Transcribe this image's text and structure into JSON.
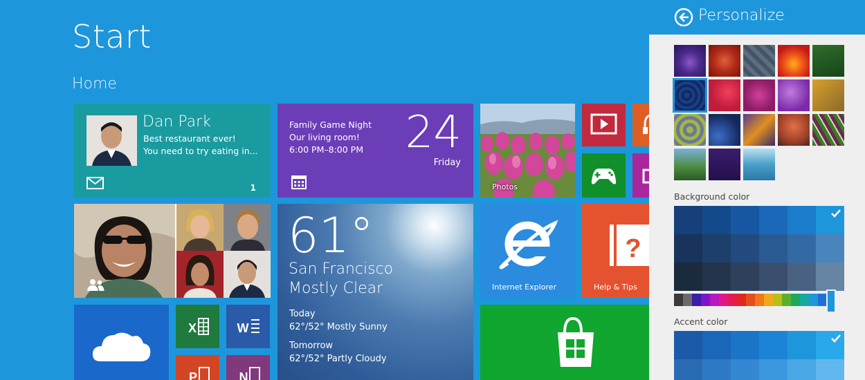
{
  "start": {
    "title": "Start",
    "group": "Home"
  },
  "mail": {
    "name": "Dan Park",
    "line1": "Best restaurant ever!",
    "line2": "You need to try eating in...",
    "count": "1"
  },
  "calendar": {
    "event_title": "Family Game Night",
    "location": "Our living room!",
    "time": "6:00 PM–8:00 PM",
    "day": "24",
    "weekday": "Friday"
  },
  "photos": {
    "label": "Photos"
  },
  "weather": {
    "temp": "61°",
    "city": "San Francisco",
    "condition": "Mostly Clear",
    "today_label": "Today",
    "today_forecast": "62°/52° Mostly Sunny",
    "tomorrow_label": "Tomorrow",
    "tomorrow_forecast": "62°/52° Partly Cloudy"
  },
  "ie": {
    "label": "Internet Explorer"
  },
  "help": {
    "label": "Help & Tips"
  },
  "office": {
    "excel_letter": "X",
    "word_letter": "W",
    "ppt_letter": "P",
    "onenote_letter": "N"
  },
  "pane": {
    "title": "Personalize",
    "background_label": "Background color",
    "accent_label": "Accent color",
    "colors": {
      "accent": "#1e96dc",
      "pane_bg": "#efefef"
    }
  }
}
